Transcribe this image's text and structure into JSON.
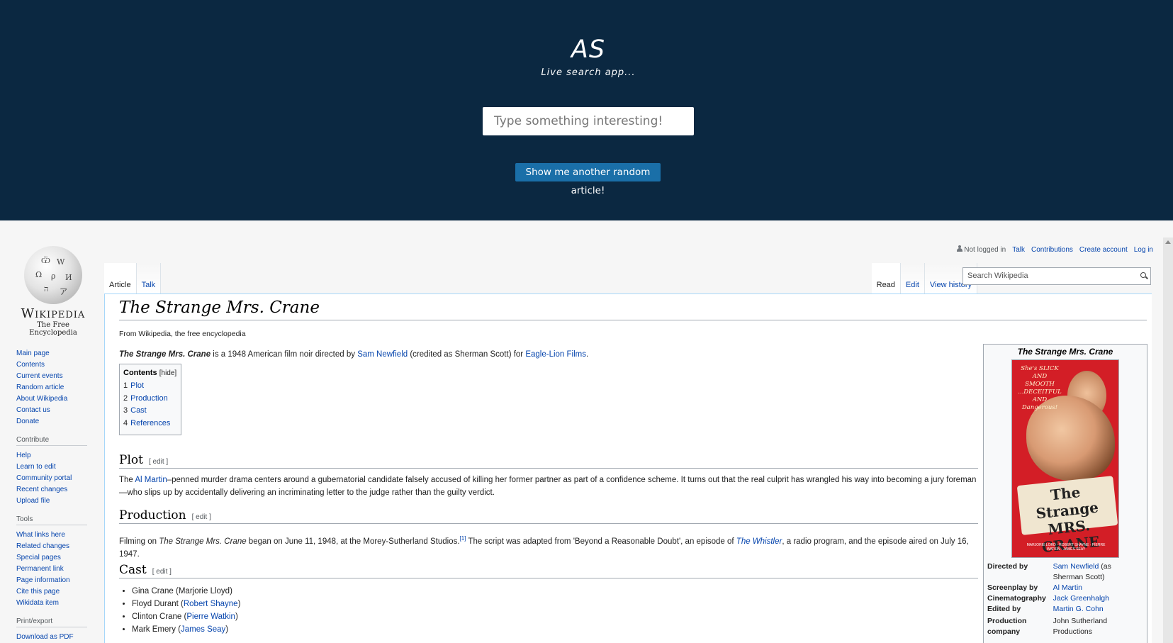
{
  "app": {
    "logo": "AS",
    "tagline": "Live search app...",
    "search_placeholder": "Type something interesting!",
    "random_button": "Show me another random article!"
  },
  "colors": {
    "header_bg": "#0b2841",
    "button_bg": "#1a6fa8",
    "link": "#0645ad"
  },
  "wiki": {
    "logo": {
      "wordmark": "Wikipedia",
      "tagline": "The Free Encyclopedia"
    },
    "nav": {
      "main": [
        "Main page",
        "Contents",
        "Current events",
        "Random article",
        "About Wikipedia",
        "Contact us",
        "Donate"
      ],
      "contribute_heading": "Contribute",
      "contribute": [
        "Help",
        "Learn to edit",
        "Community portal",
        "Recent changes",
        "Upload file"
      ],
      "tools_heading": "Tools",
      "tools": [
        "What links here",
        "Related changes",
        "Special pages",
        "Permanent link",
        "Page information",
        "Cite this page",
        "Wikidata item"
      ],
      "print_heading": "Print/export",
      "print": [
        "Download as PDF"
      ]
    },
    "personal": {
      "status": "Not logged in",
      "talk": "Talk",
      "contributions": "Contributions",
      "create_account": "Create account",
      "login": "Log in"
    },
    "tabs": {
      "article": "Article",
      "talk": "Talk",
      "read": "Read",
      "edit": "Edit",
      "history": "View history"
    },
    "search_placeholder": "Search Wikipedia",
    "article": {
      "title": "The Strange Mrs. Crane",
      "from": "From Wikipedia, the free encyclopedia",
      "lead": {
        "title_ref": "The Strange Mrs. Crane",
        "text1": " is a 1948 American film noir directed by ",
        "director_link": "Sam Newfield",
        "text2": " (credited as Sherman Scott) for ",
        "studio_link": "Eagle-Lion Films",
        "text3": "."
      },
      "toc": {
        "title": "Contents",
        "hide": "[hide]",
        "items": [
          {
            "num": "1",
            "label": "Plot"
          },
          {
            "num": "2",
            "label": "Production"
          },
          {
            "num": "3",
            "label": "Cast"
          },
          {
            "num": "4",
            "label": "References"
          }
        ]
      },
      "edit_label": "[ edit ]",
      "plot": {
        "heading": "Plot",
        "text0": "The ",
        "link": "Al Martin",
        "text1": "–penned murder drama centers around a gubernatorial candidate falsely accused of killing her former partner as part of a confidence scheme. It turns out that the real culprit has wrangled his way into becoming a jury foreman—who slips up by accidentally delivering an incriminating letter to the judge rather than the guilty verdict."
      },
      "production": {
        "heading": "Production",
        "text0": "Filming on ",
        "title_ref": "The Strange Mrs. Crane",
        "text1": " began on June 11, 1948, at the Morey-Sutherland Studios.",
        "ref": "[1]",
        "text2": " The script was adapted from 'Beyond a Reasonable Doubt', an episode of ",
        "link": "The Whistler",
        "text3": ", a radio program, and the episode aired on July 16, 1947."
      },
      "cast": {
        "heading": "Cast",
        "items": [
          {
            "role": "Gina Crane (",
            "actor": "Marjorie Lloyd",
            "link": false,
            "end": ")"
          },
          {
            "role": "Floyd Durant (",
            "actor": "Robert Shayne",
            "link": true,
            "end": ")"
          },
          {
            "role": "Clinton Crane (",
            "actor": "Pierre Watkin",
            "link": true,
            "end": ")"
          },
          {
            "role": "Mark Emery (",
            "actor": "James Seay",
            "link": true,
            "end": ")"
          }
        ]
      },
      "infobox": {
        "title": "The Strange Mrs. Crane",
        "poster": {
          "tagline": "She's SLICK AND SMOOTH ...DECEITFUL AND Dangerous!",
          "title": "The Strange MRS. CRANE",
          "credits": "MARJORIE LORD · ROBERT SHAYNE · PIERRE WATKIN · JAMES SEAY"
        },
        "rows": [
          {
            "k": "Directed by",
            "v": "Sam Newfield",
            "v2": " (as Sherman Scott)",
            "link": true
          },
          {
            "k": "Screenplay by",
            "v": "Al Martin",
            "v2": "",
            "link": true
          },
          {
            "k": "Cinematography",
            "v": "Jack Greenhalgh",
            "v2": "",
            "link": true
          },
          {
            "k": "Edited by",
            "v": "Martin G. Cohn",
            "v2": "",
            "link": true
          },
          {
            "k": "Production company",
            "v": "John Sutherland Productions",
            "v2": "",
            "link": false
          }
        ]
      }
    }
  }
}
